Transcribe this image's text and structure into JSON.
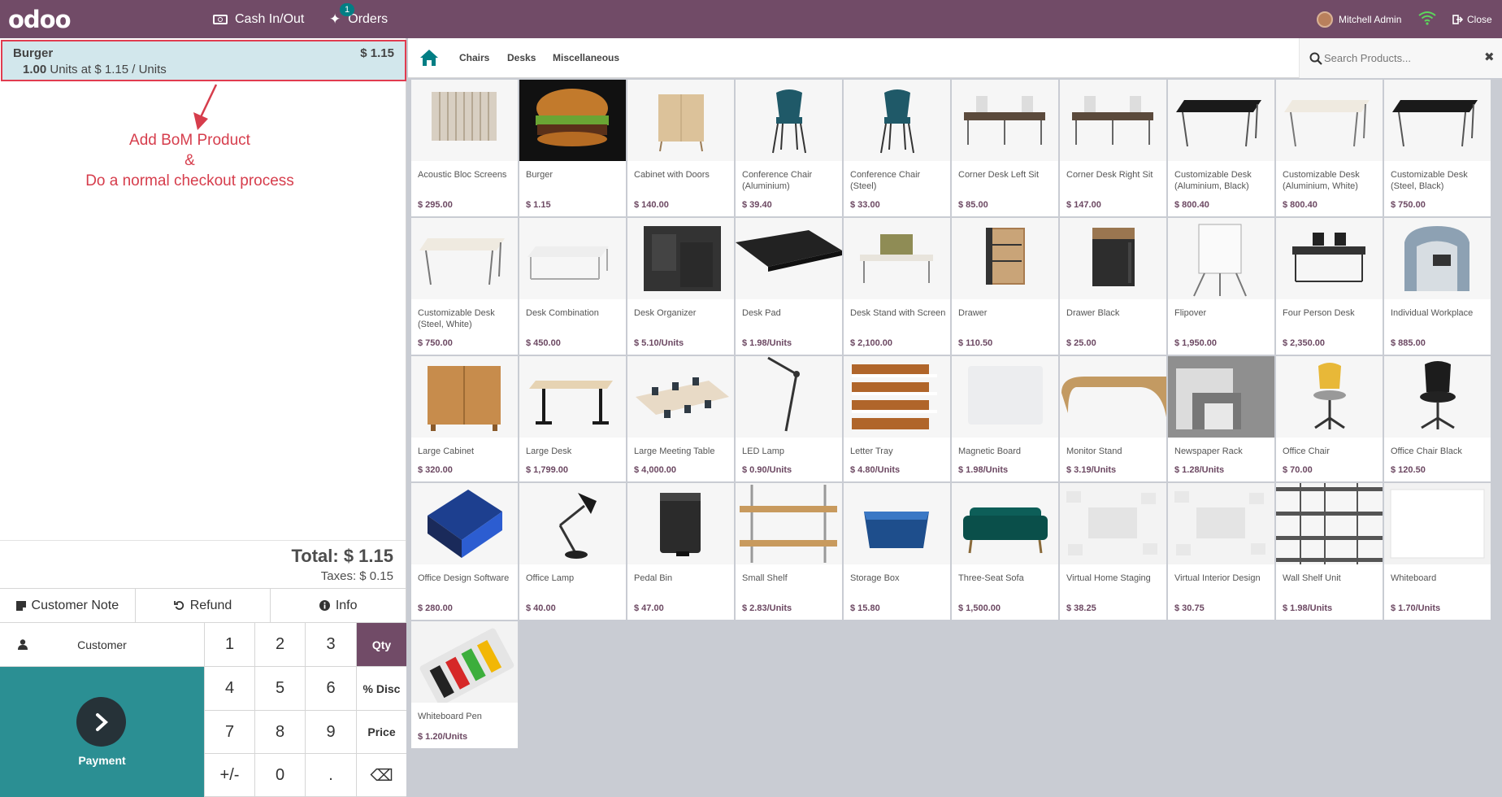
{
  "topbar": {
    "logo": "odoo",
    "cash_label": "Cash In/Out",
    "orders_label": "Orders",
    "orders_count": "1",
    "user_name": "Mitchell Admin",
    "close_label": "Close"
  },
  "order": {
    "line": {
      "name": "Burger",
      "price": "$ 1.15",
      "qty": "1.00",
      "unit_text": "Units at $ 1.15 / Units"
    },
    "total": "Total: $ 1.15",
    "taxes": "Taxes: $ 0.15"
  },
  "annotation": {
    "line1": "Add BoM Product",
    "line2": "&",
    "line3": "Do a normal checkout process"
  },
  "actions": {
    "note": "Customer Note",
    "refund": "Refund",
    "info": "Info"
  },
  "customer_label": "Customer",
  "payment_label": "Payment",
  "numpad": {
    "k1": "1",
    "k2": "2",
    "k3": "3",
    "qty": "Qty",
    "k4": "4",
    "k5": "5",
    "k6": "6",
    "disc": "% Disc",
    "k7": "7",
    "k8": "8",
    "k9": "9",
    "price": "Price",
    "plusminus": "+/-",
    "k0": "0",
    "dot": ".",
    "backspace": "⌫"
  },
  "categories": [
    "Chairs",
    "Desks",
    "Miscellaneous"
  ],
  "search": {
    "placeholder": "Search Products..."
  },
  "colors": {
    "brand": "#714b67",
    "payment": "#2b8f93",
    "selected_line": "#d2e7ec",
    "annotation": "#d63d4c"
  },
  "products": [
    {
      "name": "Acoustic Bloc Screens",
      "price": "$ 295.00",
      "icon": "screen"
    },
    {
      "name": "Burger",
      "price": "$ 1.15",
      "icon": "burger"
    },
    {
      "name": "Cabinet with Doors",
      "price": "$ 140.00",
      "icon": "cabinet"
    },
    {
      "name": "Conference Chair (Aluminium)",
      "price": "$ 39.40",
      "icon": "chair-teal"
    },
    {
      "name": "Conference Chair (Steel)",
      "price": "$ 33.00",
      "icon": "chair-teal"
    },
    {
      "name": "Corner Desk Left Sit",
      "price": "$ 85.00",
      "icon": "corner-desk"
    },
    {
      "name": "Corner Desk Right Sit",
      "price": "$ 147.00",
      "icon": "corner-desk"
    },
    {
      "name": "Customizable Desk (Aluminium, Black)",
      "price": "$ 800.40",
      "icon": "desk-black"
    },
    {
      "name": "Customizable Desk (Aluminium, White)",
      "price": "$ 800.40",
      "icon": "desk-white"
    },
    {
      "name": "Customizable Desk (Steel, Black)",
      "price": "$ 750.00",
      "icon": "desk-black"
    },
    {
      "name": "Customizable Desk (Steel, White)",
      "price": "$ 750.00",
      "icon": "desk-white"
    },
    {
      "name": "Desk Combination",
      "price": "$ 450.00",
      "icon": "desk-combo"
    },
    {
      "name": "Desk Organizer",
      "price": "$ 5.10/Units",
      "icon": "organizer"
    },
    {
      "name": "Desk Pad",
      "price": "$ 1.98/Units",
      "icon": "deskpad"
    },
    {
      "name": "Desk Stand with Screen",
      "price": "$ 2,100.00",
      "icon": "desk-stand"
    },
    {
      "name": "Drawer",
      "price": "$ 110.50",
      "icon": "drawer"
    },
    {
      "name": "Drawer Black",
      "price": "$ 25.00",
      "icon": "drawer-black"
    },
    {
      "name": "Flipover",
      "price": "$ 1,950.00",
      "icon": "flipover"
    },
    {
      "name": "Four Person Desk",
      "price": "$ 2,350.00",
      "icon": "four-desk"
    },
    {
      "name": "Individual Workplace",
      "price": "$ 885.00",
      "icon": "workplace"
    },
    {
      "name": "Large Cabinet",
      "price": "$ 320.00",
      "icon": "large-cabinet"
    },
    {
      "name": "Large Desk",
      "price": "$ 1,799.00",
      "icon": "large-desk"
    },
    {
      "name": "Large Meeting Table",
      "price": "$ 4,000.00",
      "icon": "meeting-table"
    },
    {
      "name": "LED Lamp",
      "price": "$ 0.90/Units",
      "icon": "led-lamp"
    },
    {
      "name": "Letter Tray",
      "price": "$ 4.80/Units",
      "icon": "letter-tray"
    },
    {
      "name": "Magnetic Board",
      "price": "$ 1.98/Units",
      "icon": "board"
    },
    {
      "name": "Monitor Stand",
      "price": "$ 3.19/Units",
      "icon": "monitor-stand"
    },
    {
      "name": "Newspaper Rack",
      "price": "$ 1.28/Units",
      "icon": "rack"
    },
    {
      "name": "Office Chair",
      "price": "$ 70.00",
      "icon": "office-chair"
    },
    {
      "name": "Office Chair Black",
      "price": "$ 120.50",
      "icon": "office-chair-black"
    },
    {
      "name": "Office Design Software",
      "price": "$ 280.00",
      "icon": "software-box"
    },
    {
      "name": "Office Lamp",
      "price": "$ 40.00",
      "icon": "office-lamp"
    },
    {
      "name": "Pedal Bin",
      "price": "$ 47.00",
      "icon": "bin"
    },
    {
      "name": "Small Shelf",
      "price": "$ 2.83/Units",
      "icon": "small-shelf"
    },
    {
      "name": "Storage Box",
      "price": "$ 15.80",
      "icon": "storage-box"
    },
    {
      "name": "Three-Seat Sofa",
      "price": "$ 1,500.00",
      "icon": "sofa"
    },
    {
      "name": "Virtual Home Staging",
      "price": "$ 38.25",
      "icon": "virtual"
    },
    {
      "name": "Virtual Interior Design",
      "price": "$ 30.75",
      "icon": "virtual"
    },
    {
      "name": "Wall Shelf Unit",
      "price": "$ 1.98/Units",
      "icon": "wall-shelf"
    },
    {
      "name": "Whiteboard",
      "price": "$ 1.70/Units",
      "icon": "whiteboard"
    },
    {
      "name": "Whiteboard Pen",
      "price": "$ 1.20/Units",
      "icon": "pens"
    }
  ]
}
